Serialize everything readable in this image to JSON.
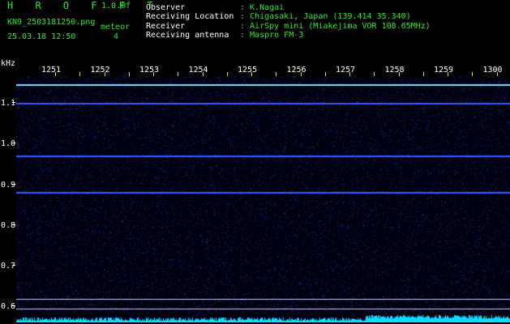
{
  "header": {
    "logo": "H R O F F T",
    "version": "1.0.0f",
    "filename": "KN9_2503181250.png",
    "datetime": "25.03.18 12:50",
    "meteor_label": "meteor",
    "meteor_count": "4",
    "info": [
      {
        "label": "Observer",
        "value": ": K.Nagai"
      },
      {
        "label": "Receiving Location",
        "value": ": Chigasaki, Japan (139.414 35.340)"
      },
      {
        "label": "Receiver",
        "value": ": AirSpy mini (Miakejima VOR 108.65MHz)"
      },
      {
        "label": "Receiving antenna",
        "value": ": Maspro FM-3"
      }
    ]
  },
  "y_axis": {
    "unit": "kHz",
    "ticks": [
      "1.1",
      "1.0",
      "0.9",
      "0.8",
      "0.7",
      "0.6"
    ]
  },
  "x_axis": {
    "ticks": [
      "1251",
      "1252",
      "1253",
      "1254",
      "1255",
      "1256",
      "1257",
      "1258",
      "1259",
      "1300"
    ]
  },
  "colors": {
    "background": "#000010",
    "signal": "#3a5cff",
    "label": "#2ee62e",
    "tick": "#ffd800",
    "noise": "#00e0ff"
  }
}
